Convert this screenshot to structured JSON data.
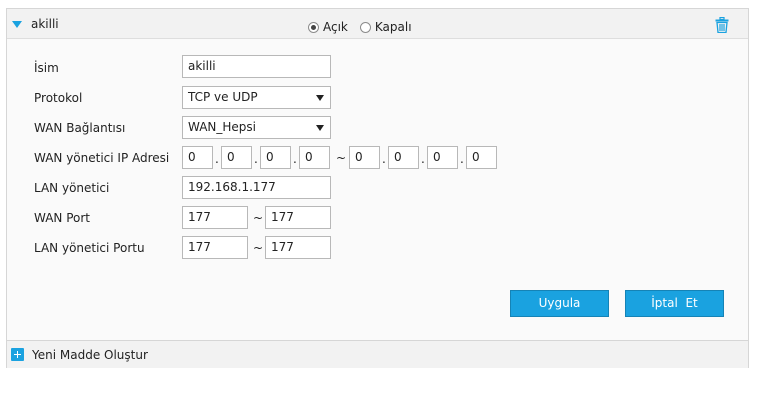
{
  "rule": {
    "name": "akilli",
    "status_on_label": "Açık",
    "status_off_label": "Kapalı",
    "status_selected": "Açık",
    "icon_delete": "trash-icon",
    "icon_collapse": "collapse-arrow-icon"
  },
  "form": {
    "name_label": "İsim",
    "name_value": "akilli",
    "protocol_label": "Protokol",
    "protocol_value": "TCP ve UDP",
    "wan_connection_label": "WAN Bağlantısı",
    "wan_connection_value": "WAN_Hepsi",
    "wan_host_ip_label": "WAN yönetici IP Adresi",
    "wan_host_ip_start": [
      "0",
      "0",
      "0",
      "0"
    ],
    "wan_host_ip_end": [
      "0",
      "0",
      "0",
      "0"
    ],
    "ip_dot": ".",
    "range_sep": "~",
    "lan_host_label": "LAN yönetici",
    "lan_host_value": "192.168.1.177",
    "wan_port_label": "WAN Port",
    "wan_port_start": "177",
    "wan_port_end": "177",
    "lan_port_label": "LAN yönetici Portu",
    "lan_port_start": "177",
    "lan_port_end": "177"
  },
  "buttons": {
    "apply_label": "Uygula",
    "cancel_label": "İptal  Et"
  },
  "footer": {
    "new_item_label": "Yeni Madde Oluştur",
    "icon_add": "plus-icon"
  },
  "colors": {
    "accent": "#1aa2e0",
    "header_bg": "#f2f2f2",
    "panel_bg": "#fafafa"
  }
}
